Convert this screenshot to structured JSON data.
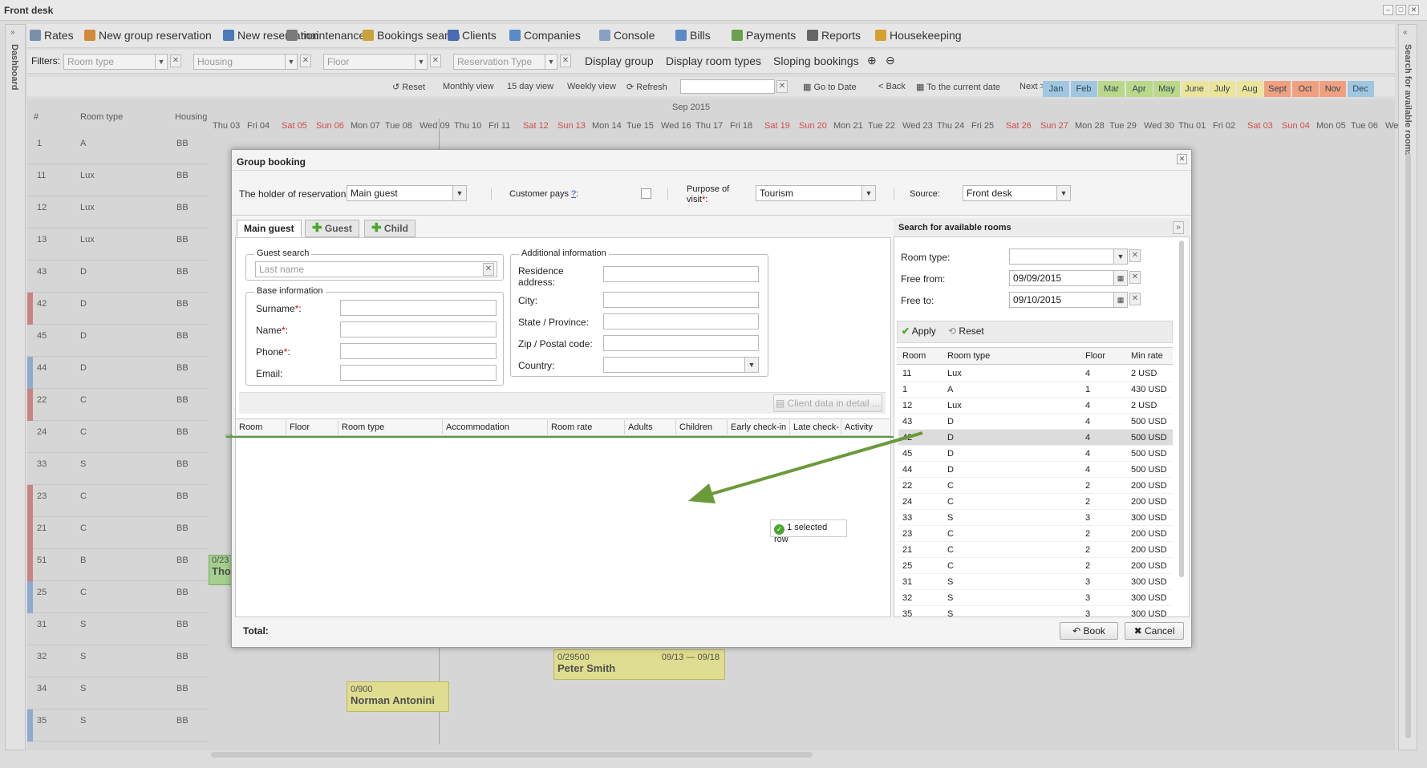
{
  "window": {
    "title": "Front desk"
  },
  "left_side": {
    "label": "Dashboard"
  },
  "right_side": {
    "label": "Search for available rooms"
  },
  "toolbar": [
    {
      "label": "Rates",
      "icon": "rates-icon",
      "color": "#7a8fa8"
    },
    {
      "label": "New group reservation",
      "icon": "group-icon",
      "color": "#d28a3a"
    },
    {
      "label": "New reservation",
      "icon": "pen-icon",
      "color": "#4a7ab8"
    },
    {
      "label": "maintenance",
      "icon": "wrench-icon",
      "color": "#7a7a7a"
    },
    {
      "label": "Bookings search",
      "icon": "magnifier-icon",
      "color": "#c9a33a"
    },
    {
      "label": "Clients",
      "icon": "clients-icon",
      "color": "#4a6ab8"
    },
    {
      "label": "Companies",
      "icon": "companies-icon",
      "color": "#5a8ac8"
    },
    {
      "label": "Console",
      "icon": "console-icon",
      "color": "#8aa0c0"
    },
    {
      "label": "Bills",
      "icon": "bills-icon",
      "color": "#5a8ac8"
    },
    {
      "label": "Payments",
      "icon": "dollar-icon",
      "color": "#6aa050"
    },
    {
      "label": "Reports",
      "icon": "printer-icon",
      "color": "#666"
    },
    {
      "label": "Housekeeping",
      "icon": "broom-icon",
      "color": "#d6a030"
    }
  ],
  "filters": {
    "label": "Filters:",
    "room_type": "Room type",
    "housing": "Housing",
    "floor": "Floor",
    "reservation_type": "Reservation Type",
    "links": [
      "Display group",
      "Display room types",
      "Sloping bookings"
    ]
  },
  "nav": {
    "reset": "Reset",
    "monthly": "Monthly view",
    "fifteen": "15 day view",
    "weekly": "Weekly view",
    "refresh": "Refresh",
    "go_to_date": "Go to Date",
    "back": "< Back",
    "to_current": "To the current date",
    "next": "Next >",
    "months": [
      {
        "label": "Jan",
        "color": "#9fc8e0"
      },
      {
        "label": "Feb",
        "color": "#9fc8e0"
      },
      {
        "label": "Mar",
        "color": "#b9d88a"
      },
      {
        "label": "Apr",
        "color": "#b9d88a"
      },
      {
        "label": "May",
        "color": "#b9d88a"
      },
      {
        "label": "June",
        "color": "#ece49a"
      },
      {
        "label": "July",
        "color": "#ece49a"
      },
      {
        "label": "Aug",
        "color": "#ece49a"
      },
      {
        "label": "Sept",
        "color": "#f0a080"
      },
      {
        "label": "Oct",
        "color": "#f0a080"
      },
      {
        "label": "Nov",
        "color": "#f0a080"
      },
      {
        "label": "Dec",
        "color": "#9fc8e0"
      }
    ]
  },
  "grid": {
    "col_num": "#",
    "col_room_type": "Room type",
    "col_housing": "Housing",
    "month_label": "Sep 2015",
    "days": [
      {
        "label": "Thu 03",
        "weekend": false
      },
      {
        "label": "Fri 04",
        "weekend": false
      },
      {
        "label": "Sat 05",
        "weekend": true
      },
      {
        "label": "Sun 06",
        "weekend": true
      },
      {
        "label": "Mon 07",
        "weekend": false
      },
      {
        "label": "Tue 08",
        "weekend": false
      },
      {
        "label": "Wed 09",
        "weekend": false
      },
      {
        "label": "Thu 10",
        "weekend": false
      },
      {
        "label": "Fri 11",
        "weekend": false
      },
      {
        "label": "Sat 12",
        "weekend": true
      },
      {
        "label": "Sun 13",
        "weekend": true
      },
      {
        "label": "Mon 14",
        "weekend": false
      },
      {
        "label": "Tue 15",
        "weekend": false
      },
      {
        "label": "Wed 16",
        "weekend": false
      },
      {
        "label": "Thu 17",
        "weekend": false
      },
      {
        "label": "Fri 18",
        "weekend": false
      },
      {
        "label": "Sat 19",
        "weekend": true
      },
      {
        "label": "Sun 20",
        "weekend": true
      },
      {
        "label": "Mon 21",
        "weekend": false
      },
      {
        "label": "Tue 22",
        "weekend": false
      },
      {
        "label": "Wed 23",
        "weekend": false
      },
      {
        "label": "Thu 24",
        "weekend": false
      },
      {
        "label": "Fri 25",
        "weekend": false
      },
      {
        "label": "Sat 26",
        "weekend": true
      },
      {
        "label": "Sun 27",
        "weekend": true
      },
      {
        "label": "Mon 28",
        "weekend": false
      },
      {
        "label": "Tue 29",
        "weekend": false
      },
      {
        "label": "Wed 30",
        "weekend": false
      },
      {
        "label": "Thu 01",
        "weekend": false
      },
      {
        "label": "Fri 02",
        "weekend": false
      },
      {
        "label": "Sat 03",
        "weekend": true
      },
      {
        "label": "Sun 04",
        "weekend": true
      },
      {
        "label": "Mon 05",
        "weekend": false
      },
      {
        "label": "Tue 06",
        "weekend": false
      },
      {
        "label": "We",
        "weekend": false
      }
    ],
    "rows": [
      {
        "num": "1",
        "type": "A",
        "housing": "BB",
        "mark": ""
      },
      {
        "num": "11",
        "type": "Lux",
        "housing": "BB",
        "mark": ""
      },
      {
        "num": "12",
        "type": "Lux",
        "housing": "BB",
        "mark": ""
      },
      {
        "num": "13",
        "type": "Lux",
        "housing": "BB",
        "mark": ""
      },
      {
        "num": "43",
        "type": "D",
        "housing": "BB",
        "mark": ""
      },
      {
        "num": "42",
        "type": "D",
        "housing": "BB",
        "mark": "#d97a7a"
      },
      {
        "num": "45",
        "type": "D",
        "housing": "BB",
        "mark": ""
      },
      {
        "num": "44",
        "type": "D",
        "housing": "BB",
        "mark": "#8aaee0"
      },
      {
        "num": "22",
        "type": "C",
        "housing": "BB",
        "mark": "#d97a7a"
      },
      {
        "num": "24",
        "type": "C",
        "housing": "BB",
        "mark": ""
      },
      {
        "num": "33",
        "type": "S",
        "housing": "BB",
        "mark": ""
      },
      {
        "num": "23",
        "type": "C",
        "housing": "BB",
        "mark": "#d97a7a"
      },
      {
        "num": "21",
        "type": "C",
        "housing": "BB",
        "mark": "#d97a7a"
      },
      {
        "num": "51",
        "type": "B",
        "housing": "BB",
        "mark": "#d97a7a"
      },
      {
        "num": "25",
        "type": "C",
        "housing": "BB",
        "mark": "#8aaee0"
      },
      {
        "num": "31",
        "type": "S",
        "housing": "BB",
        "mark": ""
      },
      {
        "num": "32",
        "type": "S",
        "housing": "BB",
        "mark": ""
      },
      {
        "num": "34",
        "type": "S",
        "housing": "BB",
        "mark": ""
      },
      {
        "num": "35",
        "type": "S",
        "housing": "BB",
        "mark": "#8aaee0"
      }
    ],
    "bookings": {
      "tho": {
        "amount": "0/23",
        "name": "Tho"
      },
      "peter": {
        "amount": "0/29500",
        "dates": "09/13 — 09/18",
        "name": "Peter Smith"
      },
      "norman": {
        "amount": "0/900",
        "name": "Norman Antonini"
      }
    }
  },
  "dialog": {
    "title": "Group booking",
    "holder_label": "The holder of reservation",
    "holder_value": "Main guest",
    "customer_pays": "Customer pays",
    "customer_pays_help": "?",
    "purpose_label": "Purpose of visit",
    "purpose_value": "Tourism",
    "source_label": "Source:",
    "source_value": "Front desk",
    "tabs": {
      "main": "Main guest",
      "guest": "Guest",
      "child": "Child"
    },
    "guest_search": "Guest search",
    "last_name_ph": "Last name",
    "base_info": "Base information",
    "surname": "Surname",
    "name": "Name",
    "phone": "Phone",
    "email": "Email:",
    "additional": "Additional information",
    "residence": "Residence address:",
    "city": "City:",
    "state": "State / Province:",
    "zip": "Zip / Postal code:",
    "country": "Country:",
    "client_detail": "Client data in detail ...",
    "cols": [
      "Room",
      "Floor",
      "Room type",
      "Accommodation",
      "Room rate",
      "Adults",
      "Children",
      "Early check-in",
      "Late check-",
      "Activity"
    ],
    "selected_rows": "1 selected row",
    "total": "Total:",
    "book": "Book",
    "cancel": "Cancel"
  },
  "search": {
    "title": "Search for available rooms",
    "room_type": "Room type:",
    "free_from": "Free from:",
    "free_from_value": "09/09/2015",
    "free_to": "Free to:",
    "free_to_value": "09/10/2015",
    "apply": "Apply",
    "reset": "Reset",
    "cols": [
      "Room",
      "Room type",
      "Floor",
      "Min rate"
    ],
    "rooms": [
      {
        "room": "11",
        "type": "Lux",
        "floor": "4",
        "rate": "2 USD"
      },
      {
        "room": "1",
        "type": "A",
        "floor": "1",
        "rate": "430 USD"
      },
      {
        "room": "12",
        "type": "Lux",
        "floor": "4",
        "rate": "2 USD"
      },
      {
        "room": "43",
        "type": "D",
        "floor": "4",
        "rate": "500 USD"
      },
      {
        "room": "42",
        "type": "D",
        "floor": "4",
        "rate": "500 USD",
        "selected": true
      },
      {
        "room": "45",
        "type": "D",
        "floor": "4",
        "rate": "500 USD"
      },
      {
        "room": "44",
        "type": "D",
        "floor": "4",
        "rate": "500 USD"
      },
      {
        "room": "22",
        "type": "C",
        "floor": "2",
        "rate": "200 USD"
      },
      {
        "room": "24",
        "type": "C",
        "floor": "2",
        "rate": "200 USD"
      },
      {
        "room": "33",
        "type": "S",
        "floor": "3",
        "rate": "300 USD"
      },
      {
        "room": "23",
        "type": "C",
        "floor": "2",
        "rate": "200 USD"
      },
      {
        "room": "21",
        "type": "C",
        "floor": "2",
        "rate": "200 USD"
      },
      {
        "room": "25",
        "type": "C",
        "floor": "2",
        "rate": "200 USD"
      },
      {
        "room": "31",
        "type": "S",
        "floor": "3",
        "rate": "300 USD"
      },
      {
        "room": "32",
        "type": "S",
        "floor": "3",
        "rate": "300 USD"
      },
      {
        "room": "35",
        "type": "S",
        "floor": "3",
        "rate": "300 USD"
      }
    ]
  }
}
